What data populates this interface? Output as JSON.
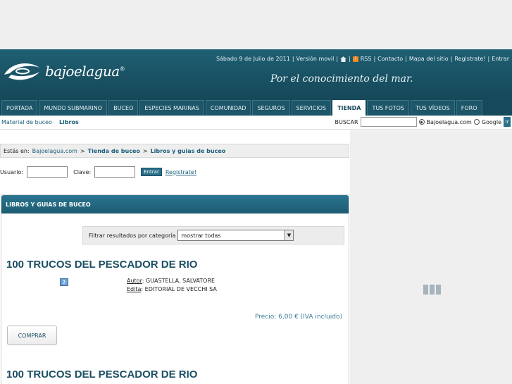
{
  "topbar": {
    "date": "Sábado 9 de Julio de 2011",
    "mobile": "Versión movil",
    "rss": "RSS",
    "contact": "Contacto",
    "sitemap": "Mapa del sitio",
    "register": "Registrate!",
    "enter": "Entrar",
    "separator": "|"
  },
  "brand": {
    "logo": "bajoelagua",
    "registered": "®",
    "tagline": "Por el conocimiento del mar."
  },
  "tabs": [
    "PORTADA",
    "MUNDO SUBMARINO",
    "BUCEO",
    "ESPECIES MARINAS",
    "COMUNIDAD",
    "SEGUROS",
    "SERVICIOS",
    "TIENDA",
    "TUS FOTOS",
    "TUS VÍDEOS",
    "FORO"
  ],
  "subnav": {
    "items": [
      "Material de buceo",
      "Libros"
    ],
    "search_label": "BUSCAR",
    "search_value": "",
    "option1": "Bajoelagua.com",
    "option2": "Google",
    "go": "Ir"
  },
  "breadcrumb": {
    "prefix": "Estás en:",
    "home": "Bajoelagua.com",
    "sep": ">",
    "shop": "Tienda de buceo",
    "current": "Libros y guias de buceo"
  },
  "login": {
    "user_label": "Usuario:",
    "pass_label": "Clave:",
    "user_value": "",
    "pass_value": "",
    "enter": "Entrar",
    "register": "Registrate!"
  },
  "panel": {
    "title": "LIBROS Y GUIAS DE BUCEO",
    "filter_label": "Filtrar resultados por categoría",
    "filter_value": "mostrar todas"
  },
  "items": [
    {
      "title": "100 TRUCOS DEL PESCADOR DE RIO",
      "thumb": "?",
      "author_label": "Autor",
      "author": ": GUASTELLA, SALVATORE",
      "publisher_label": "Edita",
      "publisher": ": EDITORIAL DE VECCHI SA",
      "price": "Precio: 6,00 € (IVA incluido)",
      "buy": "COMPRAR"
    },
    {
      "title": "100 TRUCOS DEL PESCADOR DE RIO"
    }
  ]
}
